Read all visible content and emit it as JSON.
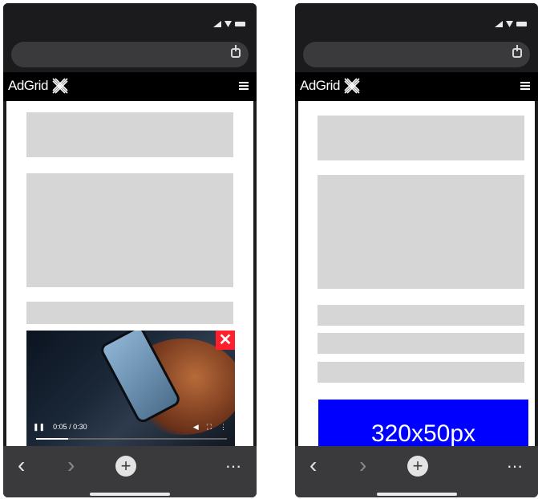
{
  "left_phone": {
    "site_logo_text": "AdGrid",
    "video": {
      "time_text": "0:05 / 0:30",
      "progress": 0.17,
      "close_label": "✕"
    },
    "toolbar": {
      "back": "‹",
      "forward": "›",
      "new_tab": "+",
      "more": "⋯"
    }
  },
  "right_phone": {
    "site_logo_text": "AdGrid",
    "ad_banner_text": "320x50px",
    "toolbar": {
      "back": "‹",
      "forward": "›",
      "new_tab": "+",
      "more": "⋯"
    }
  },
  "colors": {
    "ad_banner_bg": "#0000ff",
    "close_button_bg": "#ff1f2c",
    "placeholder_block": "#d6d6d6"
  },
  "icons": [
    "share-icon",
    "menu-icon",
    "signal-icon",
    "wifi-icon",
    "battery-icon",
    "close-icon",
    "play-pause-icon",
    "volume-icon",
    "fullscreen-icon",
    "more-icon",
    "back-icon",
    "forward-icon",
    "new-tab-icon"
  ]
}
